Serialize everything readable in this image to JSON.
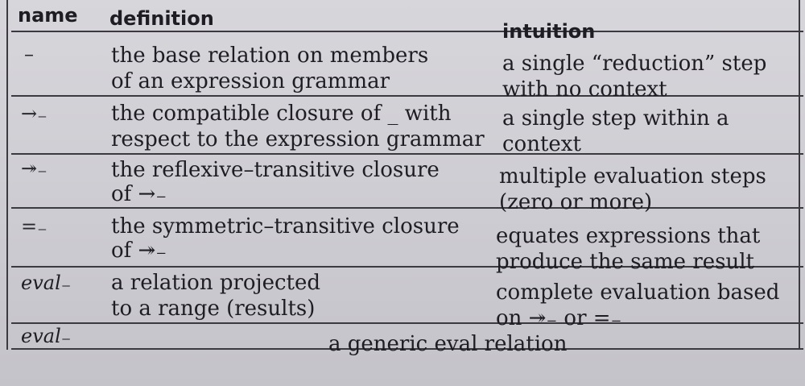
{
  "header": {
    "name": "name",
    "definition": "definition",
    "intuition": "intuition"
  },
  "rows": [
    {
      "name": "–",
      "definition": [
        "the base relation on members",
        "of an expression grammar"
      ],
      "intuition": [
        "a single “reduction” step",
        "with no context"
      ]
    },
    {
      "name": "→₋",
      "definition": [
        "the compatible closure of _ with",
        "respect to the expression grammar"
      ],
      "intuition": [
        "a single step within a",
        "context"
      ]
    },
    {
      "name": "↠₋",
      "definition": [
        "the reflexive–transitive closure",
        "of →₋"
      ],
      "intuition": [
        "multiple evaluation steps",
        "(zero or more)"
      ]
    },
    {
      "name": "=₋",
      "definition": [
        "the symmetric–transitive closure",
        "of ↠₋"
      ],
      "intuition": [
        "equates expressions that",
        "produce the same result"
      ]
    },
    {
      "name": "eval₋",
      "definition": [
        "a relation projected",
        "to a range (results)"
      ],
      "intuition": [
        "complete evaluation based",
        "on ↠₋  or =₋"
      ]
    },
    {
      "name": "eval₋",
      "definition_span": "a generic eval relation"
    }
  ]
}
